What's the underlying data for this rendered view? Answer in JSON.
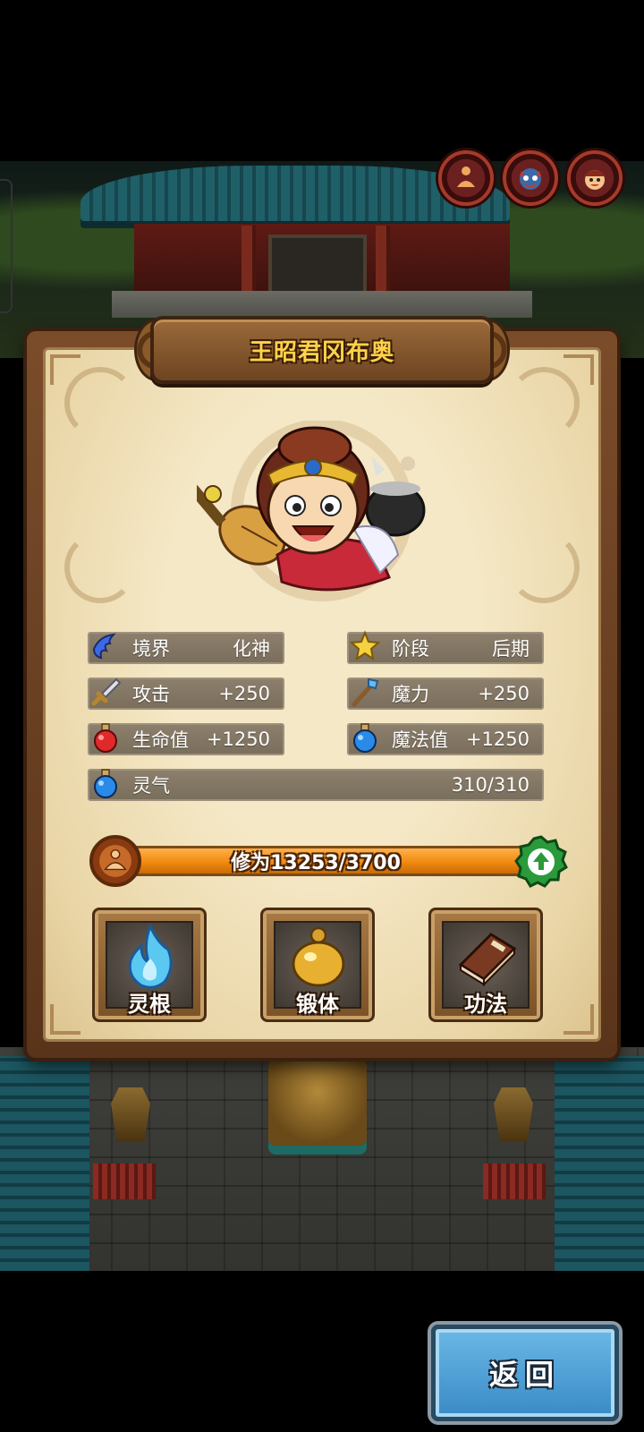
{
  "character": {
    "name": "王昭君冈布奥"
  },
  "stats": {
    "realm": {
      "label": "境界",
      "value": "化神",
      "icon": "wings-icon"
    },
    "stage": {
      "label": "阶段",
      "value": "后期",
      "icon": "star-icon"
    },
    "attack": {
      "label": "攻击",
      "value": "+250",
      "icon": "sword-icon"
    },
    "magic": {
      "label": "魔力",
      "value": "+250",
      "icon": "staff-icon"
    },
    "hp": {
      "label": "生命值",
      "value": "+1250",
      "icon": "red-potion-icon"
    },
    "mp": {
      "label": "魔法值",
      "value": "+1250",
      "icon": "blue-potion-icon"
    },
    "spirit": {
      "label": "灵气",
      "value": "310/310",
      "icon": "blue-potion-icon"
    }
  },
  "cultivation": {
    "text": "修为13253/3700",
    "progress": 1.0
  },
  "skills": [
    {
      "label": "灵根",
      "icon": "blue-flame-icon"
    },
    {
      "label": "锻体",
      "icon": "golden-gourd-icon"
    },
    {
      "label": "功法",
      "icon": "book-icon"
    }
  ],
  "top_icons": [
    "meditate-avatar-icon",
    "demon-mask-icon",
    "character-portrait-icon"
  ],
  "back_button": {
    "label": "返回"
  },
  "colors": {
    "title_gold": "#ffd24a",
    "xp_orange": "#f08a10",
    "back_blue": "#3a8ac6",
    "upgrade_green": "#2a9a3a"
  }
}
